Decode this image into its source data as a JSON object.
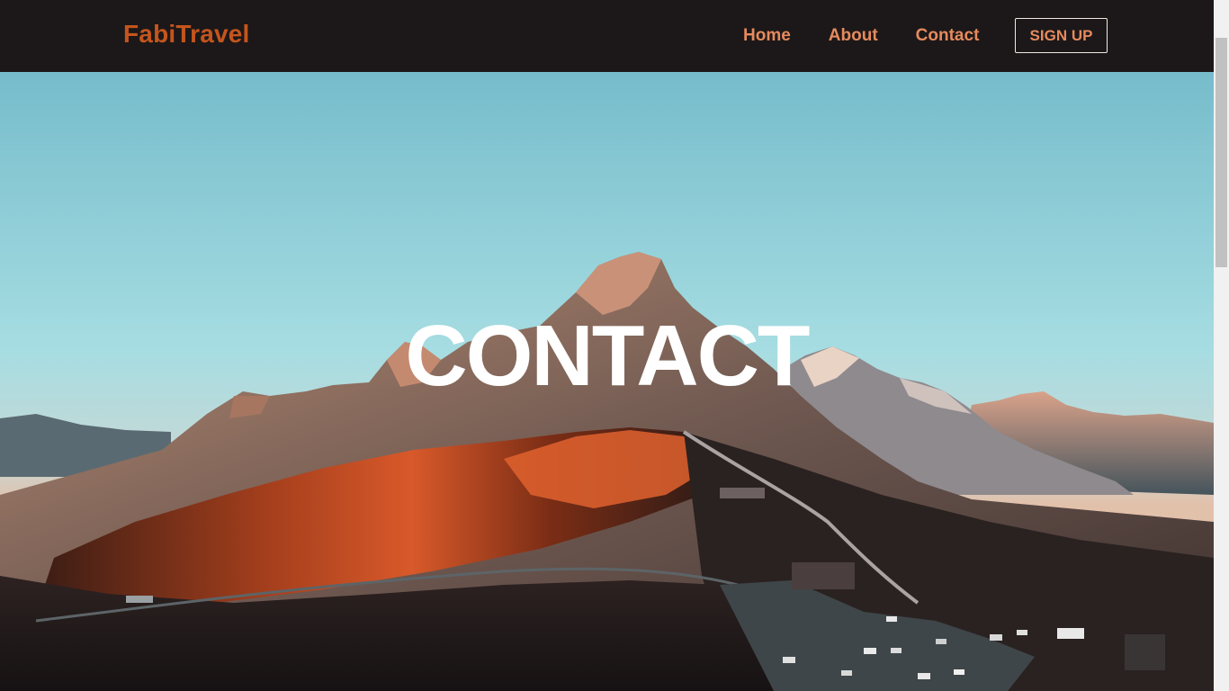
{
  "navbar": {
    "brand": "FabiTravel",
    "links": [
      {
        "label": "Home"
      },
      {
        "label": "About"
      },
      {
        "label": "Contact"
      }
    ],
    "signup_label": "SIGN UP"
  },
  "hero": {
    "title": "CONTACT",
    "image_icon": "mountain-landscape"
  },
  "colors": {
    "navbar_bg": "#1c1819",
    "brand": "#c4551d",
    "nav_link": "#e58a5d",
    "hero_title": "#ffffff"
  }
}
